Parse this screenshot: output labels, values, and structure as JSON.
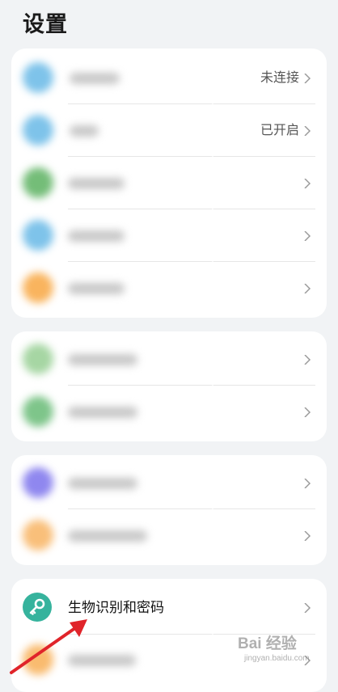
{
  "header": {
    "title": "设置"
  },
  "groups": [
    {
      "rows": [
        {
          "icon": "wifi-icon",
          "color": "#7ec3ea",
          "value": "未连接",
          "blur_w": 82
        },
        {
          "icon": "bluetooth-icon",
          "color": "#7ec3ea",
          "value": "已开启",
          "blur_w": 46
        },
        {
          "icon": "network-icon",
          "color": "#74bd78",
          "value": "",
          "blur_w": 88
        },
        {
          "icon": "connection-icon",
          "color": "#7ec3ea",
          "value": "",
          "blur_w": 88
        },
        {
          "icon": "apps-icon",
          "color": "#f9b45e",
          "value": "",
          "blur_w": 88
        }
      ]
    },
    {
      "rows": [
        {
          "icon": "notification-icon",
          "color": "#a6d6a3",
          "value": "",
          "blur_w": 106
        },
        {
          "icon": "display-icon",
          "color": "#7ec58a",
          "value": "",
          "blur_w": 106
        }
      ]
    },
    {
      "rows": [
        {
          "icon": "sound-icon",
          "color": "#8f87ef",
          "value": "",
          "blur_w": 106
        },
        {
          "icon": "desktop-icon",
          "color": "#f9bf7a",
          "value": "",
          "blur_w": 118
        }
      ]
    },
    {
      "rows": [
        {
          "icon": "key-icon",
          "color": "#36b39d",
          "label": "生物识别和密码",
          "value": ""
        },
        {
          "icon": "security-icon",
          "color": "#f9bb6f",
          "value": "",
          "blur_w": 104
        }
      ]
    }
  ],
  "watermark": {
    "main": "Bai 经验",
    "sub": "jingyan.baidu.com"
  },
  "annotation": {
    "arrow_color": "#e0242a"
  }
}
